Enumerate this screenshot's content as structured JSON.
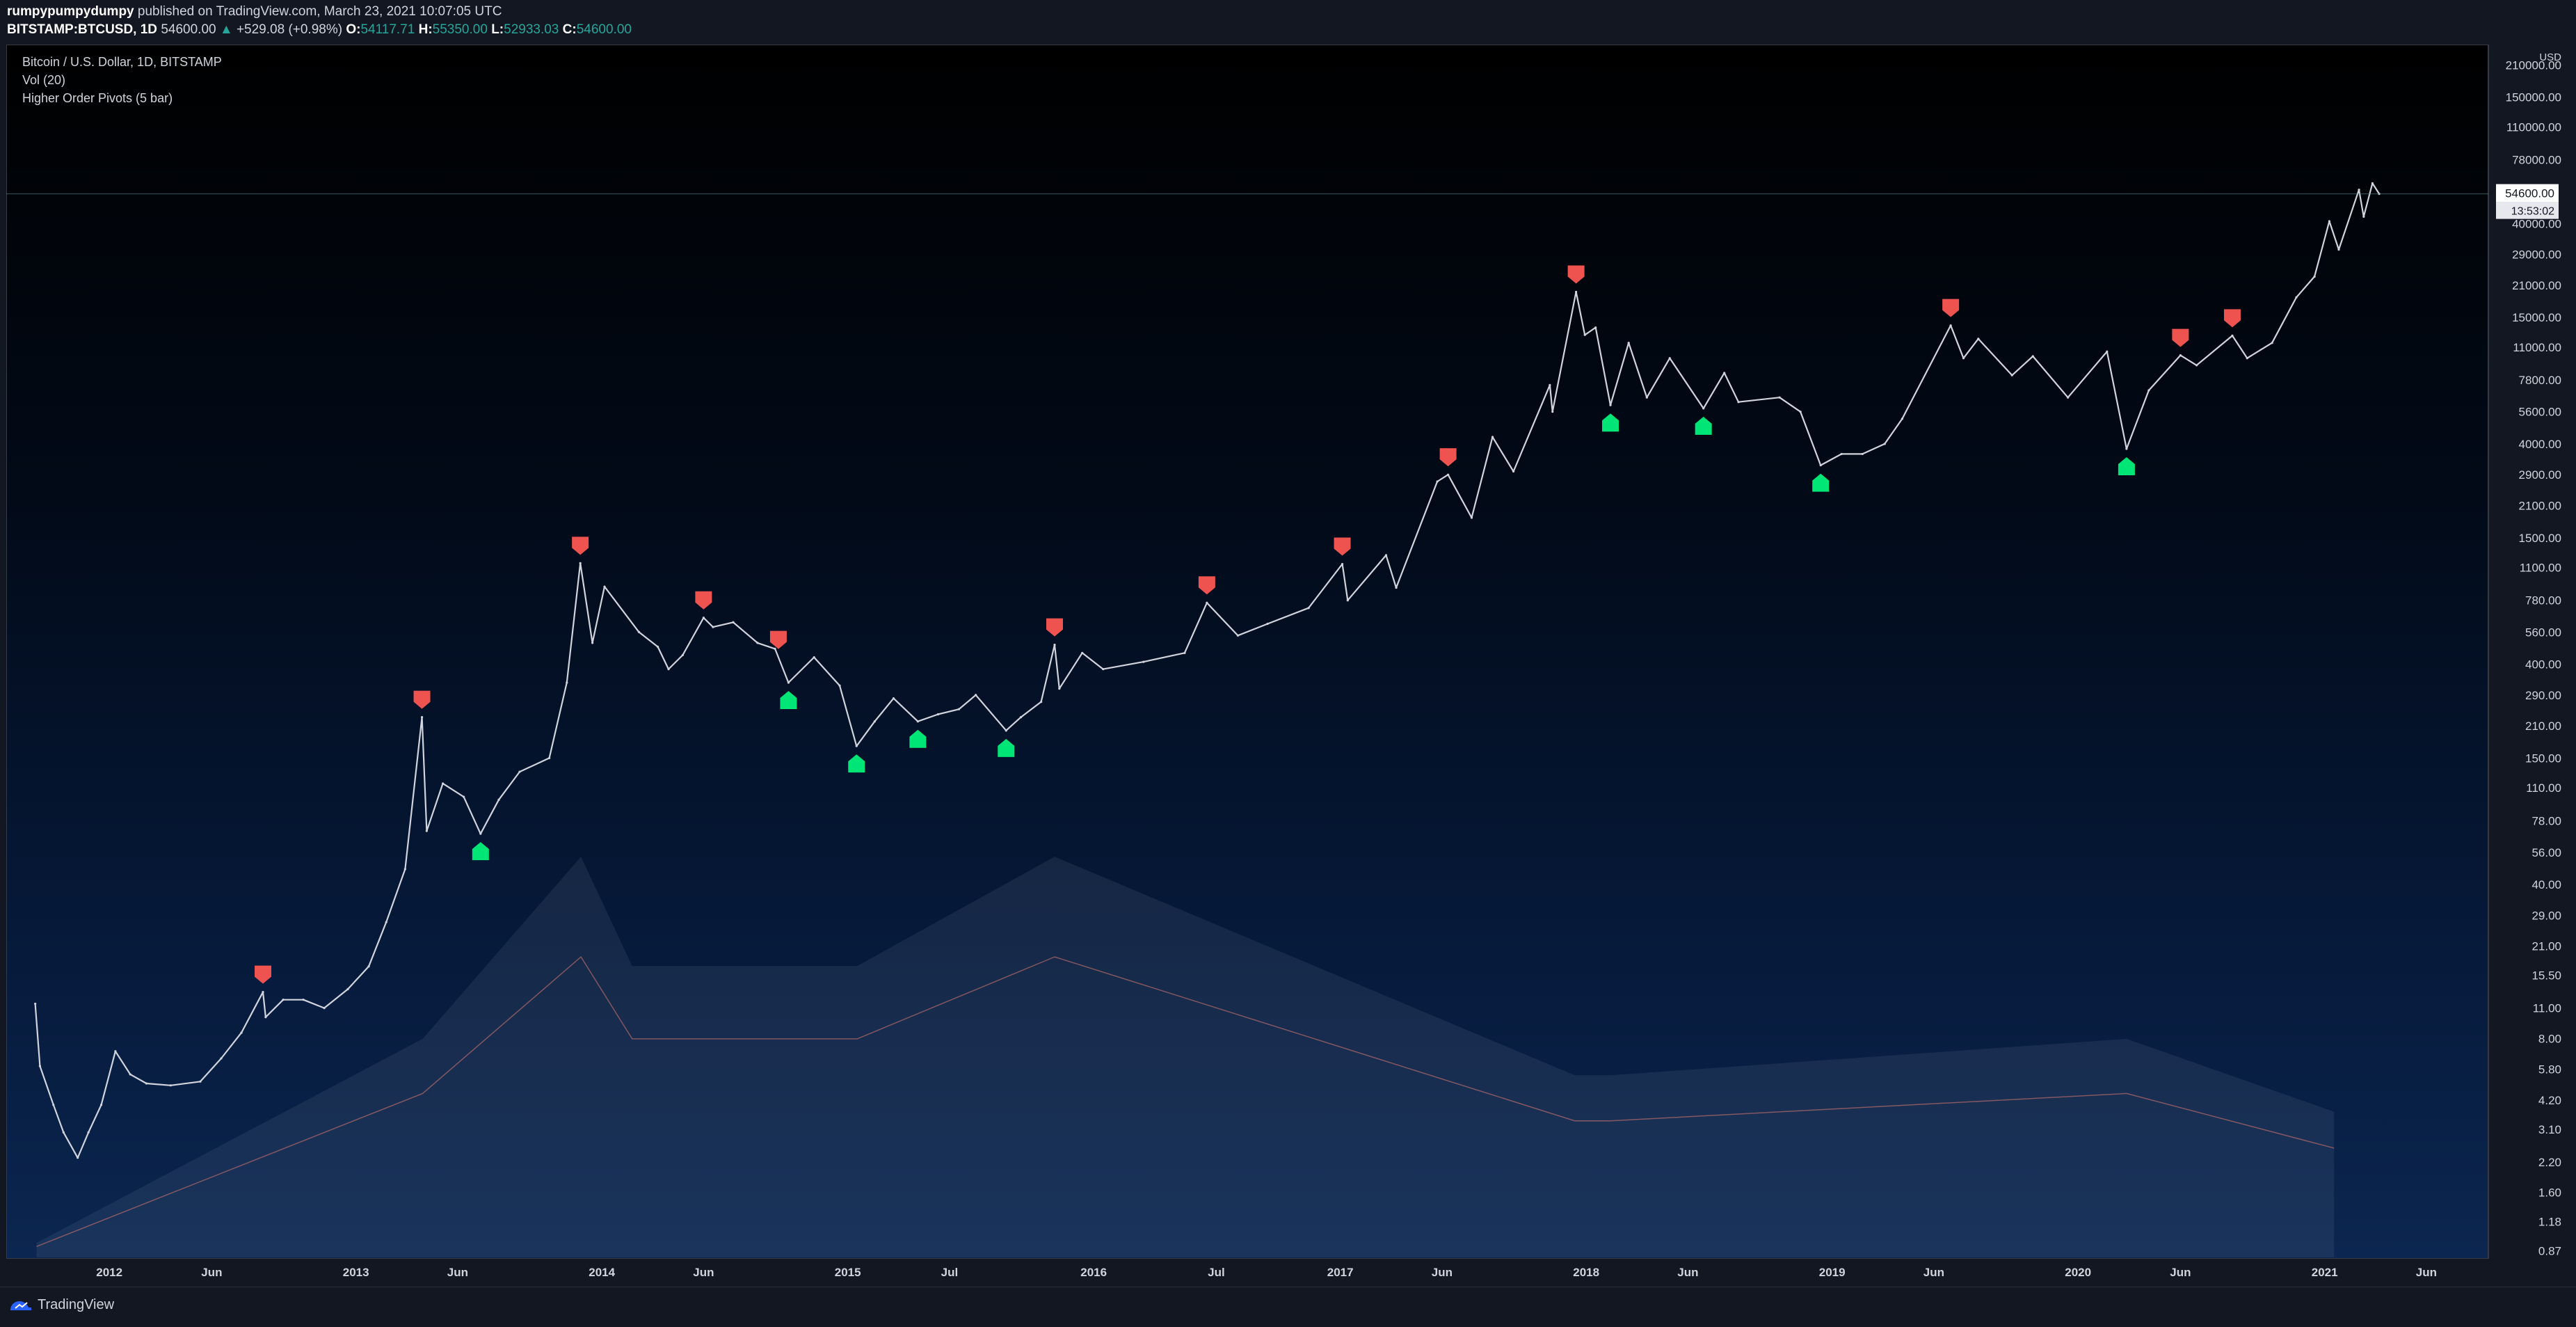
{
  "header": {
    "author": "rumpypumpydumpy",
    "published_text": "published on TradingView.com, March 23, 2021 10:07:05 UTC",
    "symbol": "BITSTAMP:BTCUSD, 1D",
    "last_price": "54600.00",
    "change_arrow": "▲",
    "change": "+529.08 (+0.98%)",
    "o_label": "O:",
    "o_value": "54117.71",
    "h_label": "H:",
    "h_value": "55350.00",
    "l_label": "L:",
    "l_value": "52933.03",
    "c_label": "C:",
    "c_value": "54600.00"
  },
  "legend": {
    "title": "Bitcoin / U.S. Dollar, 1D, BITSTAMP",
    "volume": "Vol (20)",
    "indicator": "Higher Order Pivots (5 bar)"
  },
  "footer": {
    "brand": "TradingView",
    "brand_icon": "tradingview-logo-icon"
  },
  "colors": {
    "candle": "#d1d4dc",
    "pivot_high": "#ef5350",
    "pivot_low": "#00e676",
    "volume": "#8f9bb3",
    "volume_ma": "#b36a6a",
    "axis_text": "#d1d4dc"
  },
  "chart_data": {
    "type": "line",
    "title": "Bitcoin / U.S. Dollar, 1D, BITSTAMP",
    "yscale": "log",
    "y_unit": "USD",
    "ylim": [
      0.8,
      260000
    ],
    "x_range": [
      "2011-08-01",
      "2021-09-01"
    ],
    "y_ticks": [
      "210000.00",
      "150000.00",
      "110000.00",
      "78000.00",
      "40000.00",
      "29000.00",
      "21000.00",
      "15000.00",
      "11000.00",
      "7800.00",
      "5600.00",
      "4000.00",
      "2900.00",
      "2100.00",
      "1500.00",
      "1100.00",
      "780.00",
      "560.00",
      "400.00",
      "290.00",
      "210.00",
      "150.00",
      "110.00",
      "78.00",
      "56.00",
      "40.00",
      "29.00",
      "21.00",
      "15.50",
      "11.00",
      "8.00",
      "5.80",
      "4.20",
      "3.10",
      "2.20",
      "1.60",
      "1.18",
      "0.87"
    ],
    "x_ticks": [
      {
        "date": "2012-01-01",
        "label": "2012"
      },
      {
        "date": "2012-06-01",
        "label": "Jun"
      },
      {
        "date": "2013-01-01",
        "label": "2013"
      },
      {
        "date": "2013-06-01",
        "label": "Jun"
      },
      {
        "date": "2014-01-01",
        "label": "2014"
      },
      {
        "date": "2014-06-01",
        "label": "Jun"
      },
      {
        "date": "2015-01-01",
        "label": "2015"
      },
      {
        "date": "2015-06-01",
        "label": "Jul"
      },
      {
        "date": "2016-01-01",
        "label": "2016"
      },
      {
        "date": "2016-07-01",
        "label": "Jul"
      },
      {
        "date": "2017-01-01",
        "label": "2017"
      },
      {
        "date": "2017-06-01",
        "label": "Jun"
      },
      {
        "date": "2018-01-01",
        "label": "2018"
      },
      {
        "date": "2018-06-01",
        "label": "Jun"
      },
      {
        "date": "2019-01-01",
        "label": "2019"
      },
      {
        "date": "2019-06-01",
        "label": "Jun"
      },
      {
        "date": "2020-01-01",
        "label": "2020"
      },
      {
        "date": "2020-06-01",
        "label": "Jun"
      },
      {
        "date": "2021-01-01",
        "label": "2021"
      },
      {
        "date": "2021-06-01",
        "label": "Jun"
      }
    ],
    "last_price_label": "54600.00",
    "countdown_label": "13:53:02",
    "series": [
      {
        "name": "BTCUSD",
        "points": [
          [
            "2011-09-13",
            11.5
          ],
          [
            "2011-09-20",
            6.0
          ],
          [
            "2011-10-10",
            4.0
          ],
          [
            "2011-10-25",
            3.0
          ],
          [
            "2011-11-15",
            2.3
          ],
          [
            "2011-12-01",
            3.0
          ],
          [
            "2011-12-20",
            4.0
          ],
          [
            "2012-01-10",
            7.0
          ],
          [
            "2012-02-01",
            5.5
          ],
          [
            "2012-02-25",
            5.0
          ],
          [
            "2012-04-01",
            4.9
          ],
          [
            "2012-05-15",
            5.1
          ],
          [
            "2012-06-15",
            6.5
          ],
          [
            "2012-07-15",
            8.5
          ],
          [
            "2012-08-16",
            13.0
          ],
          [
            "2012-08-20",
            10.0
          ],
          [
            "2012-09-15",
            12.0
          ],
          [
            "2012-10-15",
            12.0
          ],
          [
            "2012-11-15",
            11.0
          ],
          [
            "2012-12-20",
            13.4
          ],
          [
            "2013-01-20",
            17.0
          ],
          [
            "2013-02-15",
            27.0
          ],
          [
            "2013-03-15",
            47.0
          ],
          [
            "2013-04-09",
            230.0
          ],
          [
            "2013-04-16",
            70.0
          ],
          [
            "2013-05-10",
            115.0
          ],
          [
            "2013-06-10",
            100.0
          ],
          [
            "2013-07-05",
            68.0
          ],
          [
            "2013-08-01",
            97.0
          ],
          [
            "2013-09-01",
            130.0
          ],
          [
            "2013-10-15",
            150.0
          ],
          [
            "2013-11-10",
            330.0
          ],
          [
            "2013-11-30",
            1150.0
          ],
          [
            "2013-12-18",
            500.0
          ],
          [
            "2014-01-05",
            900.0
          ],
          [
            "2014-02-25",
            560.0
          ],
          [
            "2014-03-25",
            480.0
          ],
          [
            "2014-04-10",
            380.0
          ],
          [
            "2014-05-01",
            440.0
          ],
          [
            "2014-06-01",
            650.0
          ],
          [
            "2014-06-15",
            590.0
          ],
          [
            "2014-07-15",
            620.0
          ],
          [
            "2014-08-20",
            500.0
          ],
          [
            "2014-09-15",
            470.0
          ],
          [
            "2014-10-05",
            330.0
          ],
          [
            "2014-11-12",
            430.0
          ],
          [
            "2014-12-20",
            320.0
          ],
          [
            "2015-01-14",
            170.0
          ],
          [
            "2015-02-10",
            220.0
          ],
          [
            "2015-03-10",
            280.0
          ],
          [
            "2015-04-15",
            220.0
          ],
          [
            "2015-05-15",
            237.0
          ],
          [
            "2015-06-15",
            250.0
          ],
          [
            "2015-07-10",
            290.0
          ],
          [
            "2015-08-24",
            200.0
          ],
          [
            "2015-09-15",
            230.0
          ],
          [
            "2015-10-15",
            270.0
          ],
          [
            "2015-11-04",
            490.0
          ],
          [
            "2015-11-11",
            310.0
          ],
          [
            "2015-12-15",
            450.0
          ],
          [
            "2016-01-15",
            380.0
          ],
          [
            "2016-03-15",
            410.0
          ],
          [
            "2016-05-15",
            450.0
          ],
          [
            "2016-06-17",
            760.0
          ],
          [
            "2016-08-02",
            540.0
          ],
          [
            "2016-09-15",
            610.0
          ],
          [
            "2016-11-15",
            720.0
          ],
          [
            "2017-01-04",
            1140.0
          ],
          [
            "2017-01-12",
            780.0
          ],
          [
            "2017-03-10",
            1250.0
          ],
          [
            "2017-03-25",
            890.0
          ],
          [
            "2017-05-25",
            2700.0
          ],
          [
            "2017-06-10",
            2900.0
          ],
          [
            "2017-07-15",
            1850.0
          ],
          [
            "2017-08-15",
            4300.0
          ],
          [
            "2017-09-15",
            3000.0
          ],
          [
            "2017-11-08",
            7400.0
          ],
          [
            "2017-11-12",
            5600.0
          ],
          [
            "2017-12-17",
            19600.0
          ],
          [
            "2017-12-30",
            12500.0
          ],
          [
            "2018-01-15",
            13500.0
          ],
          [
            "2018-02-06",
            6000.0
          ],
          [
            "2018-03-05",
            11500.0
          ],
          [
            "2018-04-01",
            6500.0
          ],
          [
            "2018-05-05",
            9800.0
          ],
          [
            "2018-06-24",
            5800.0
          ],
          [
            "2018-07-25",
            8400.0
          ],
          [
            "2018-08-15",
            6200.0
          ],
          [
            "2018-10-15",
            6500.0
          ],
          [
            "2018-11-15",
            5600.0
          ],
          [
            "2018-12-15",
            3200.0
          ],
          [
            "2019-01-15",
            3600.0
          ],
          [
            "2019-02-15",
            3600.0
          ],
          [
            "2019-03-20",
            4000.0
          ],
          [
            "2019-04-15",
            5200.0
          ],
          [
            "2019-06-26",
            13800.0
          ],
          [
            "2019-07-15",
            9800.0
          ],
          [
            "2019-08-06",
            12000.0
          ],
          [
            "2019-09-25",
            8200.0
          ],
          [
            "2019-10-26",
            10000.0
          ],
          [
            "2019-12-17",
            6500.0
          ],
          [
            "2020-02-13",
            10500.0
          ],
          [
            "2020-03-13",
            3800.0
          ],
          [
            "2020-04-15",
            7000.0
          ],
          [
            "2020-06-01",
            10100.0
          ],
          [
            "2020-06-25",
            9100.0
          ],
          [
            "2020-08-17",
            12400.0
          ],
          [
            "2020-09-08",
            9800.0
          ],
          [
            "2020-10-15",
            11500.0
          ],
          [
            "2020-11-20",
            18500.0
          ],
          [
            "2020-12-17",
            23000.0
          ],
          [
            "2021-01-08",
            41000.0
          ],
          [
            "2021-01-22",
            30500.0
          ],
          [
            "2021-02-21",
            57000.0
          ],
          [
            "2021-02-28",
            43000.0
          ],
          [
            "2021-03-13",
            61000.0
          ],
          [
            "2021-03-23",
            54600.0
          ]
        ]
      }
    ],
    "pivot_highs": [
      [
        "2012-08-16",
        13.0
      ],
      [
        "2013-04-09",
        230.0
      ],
      [
        "2013-11-30",
        1150.0
      ],
      [
        "2014-06-01",
        650.0
      ],
      [
        "2014-09-20",
        430.0
      ],
      [
        "2015-11-04",
        490.0
      ],
      [
        "2016-06-17",
        760.0
      ],
      [
        "2017-01-04",
        1140.0
      ],
      [
        "2017-06-10",
        2900.0
      ],
      [
        "2017-12-17",
        19600.0
      ],
      [
        "2019-06-26",
        13800.0
      ],
      [
        "2020-06-01",
        10100.0
      ],
      [
        "2020-08-17",
        12400.0
      ]
    ],
    "pivot_lows": [
      [
        "2013-07-05",
        68.0
      ],
      [
        "2014-10-05",
        330.0
      ],
      [
        "2015-01-14",
        170.0
      ],
      [
        "2015-04-15",
        220.0
      ],
      [
        "2015-08-24",
        200.0
      ],
      [
        "2018-02-06",
        6000.0
      ],
      [
        "2018-06-24",
        5800.0
      ],
      [
        "2018-12-15",
        3200.0
      ],
      [
        "2020-03-13",
        3800.0
      ]
    ],
    "volume": {
      "name": "Vol (20)",
      "peaks": [
        [
          "2011-09-15",
          0.02
        ],
        [
          "2013-04-10",
          0.3
        ],
        [
          "2013-12-01",
          0.55
        ],
        [
          "2014-02-15",
          0.4
        ],
        [
          "2015-01-15",
          0.4
        ],
        [
          "2015-11-04",
          0.55
        ],
        [
          "2017-12-15",
          0.25
        ],
        [
          "2018-02-06",
          0.25
        ],
        [
          "2020-03-13",
          0.3
        ],
        [
          "2021-01-15",
          0.2
        ]
      ]
    }
  }
}
